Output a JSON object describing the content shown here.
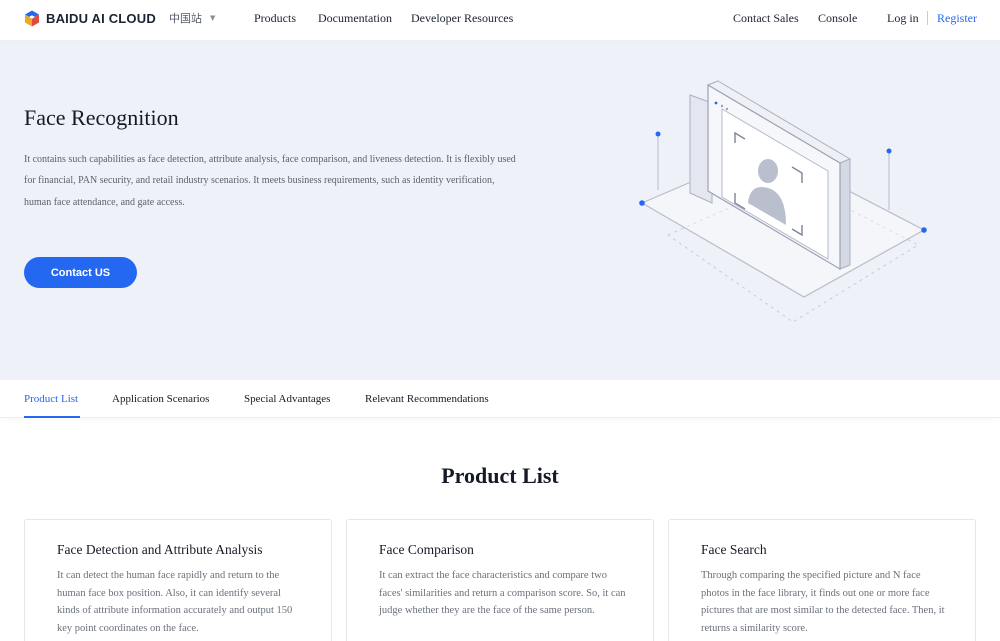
{
  "header": {
    "logo_text": "BAIDU AI CLOUD",
    "region": "中国站",
    "nav": [
      "Products",
      "Documentation",
      "Developer Resources"
    ],
    "contact_sales": "Contact Sales",
    "console": "Console",
    "login": "Log in",
    "register": "Register"
  },
  "hero": {
    "title": "Face Recognition",
    "description": "It contains such capabilities as face detection, attribute analysis, face comparison, and liveness detection. It is flexibly used for financial, PAN security, and retail industry scenarios. It meets business requirements, such as identity verification, human face attendance, and gate access.",
    "button": "Contact US"
  },
  "tabs": {
    "items": [
      "Product List",
      "Application Scenarios",
      "Special Advantages",
      "Relevant Recommendations"
    ],
    "active": "Product List"
  },
  "products": {
    "title": "Product List",
    "cards": [
      {
        "title": "Face Detection and Attribute Analysis",
        "description": "It can detect the human face rapidly and return to the human face box position. Also, it can identify several kinds of attribute information accurately and output 150 key point coordinates on the face."
      },
      {
        "title": "Face Comparison",
        "description": "It can extract the face characteristics and compare two faces' similarities and return a comparison score. So, it can judge whether they are the face of the same person."
      },
      {
        "title": "Face Search",
        "description": "Through comparing the specified picture and N face photos in the face library, it finds out one or more face pictures that are most similar to the detected face. Then, it returns a similarity score."
      }
    ]
  },
  "colors": {
    "accent": "#2468f2",
    "hero_bg": "#eef1f7",
    "text": "#151a26",
    "muted": "#6b707b"
  },
  "icons": {
    "logo": "baidu-hexagon-logo",
    "region_caret": "chevron-down-icon",
    "hero_illustration": "face-recognition-isometric-illustration"
  }
}
